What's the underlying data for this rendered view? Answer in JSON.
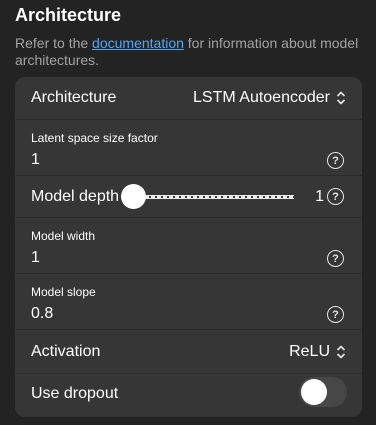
{
  "section": {
    "title": "Architecture",
    "description_before": "Refer to the ",
    "description_link": "documentation",
    "description_after": " for information about model architectures."
  },
  "fields": {
    "architecture": {
      "label": "Architecture",
      "value": "LSTM Autoencoder"
    },
    "latent": {
      "label": "Latent space size factor",
      "value": "1"
    },
    "depth": {
      "label": "Model depth",
      "value": "1",
      "slider_fraction": 0
    },
    "width": {
      "label": "Model width",
      "value": "1"
    },
    "slope": {
      "label": "Model slope",
      "value": "0.8"
    },
    "activation": {
      "label": "Activation",
      "value": "ReLU"
    },
    "dropout": {
      "label": "Use dropout",
      "enabled": false
    }
  },
  "help_glyph": "?",
  "colors": {
    "link": "#4ea8f5",
    "card": "#363636",
    "background": "#232323"
  }
}
